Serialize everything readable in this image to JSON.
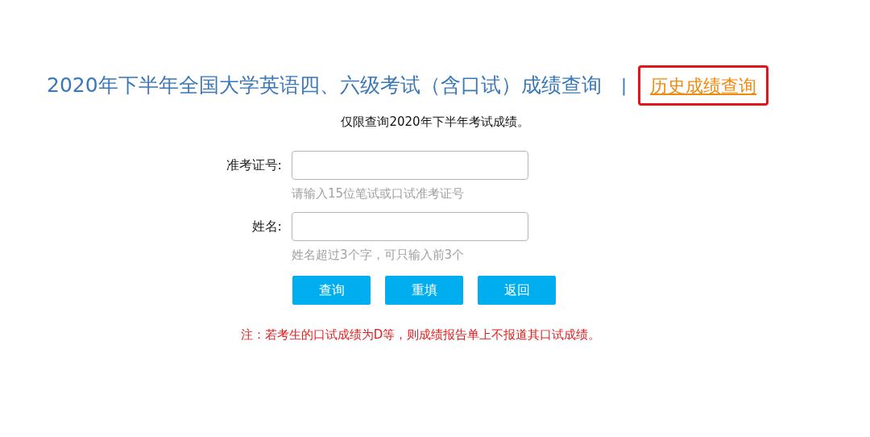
{
  "header": {
    "title": "2020年下半年全国大学英语四、六级考试（含口试）成绩查询",
    "separator": "|",
    "history_link": {
      "label": "历史成绩查询",
      "highlighted": true
    }
  },
  "subtitle": "仅限查询2020年下半年考试成绩。",
  "fields": [
    {
      "label": "准考证号:",
      "hint": "请输入15位笔试或口试准考证号"
    },
    {
      "label": "姓名:",
      "hint": "姓名超过3个字，可只输入前3个"
    }
  ],
  "buttons": [
    "查询",
    "重填",
    "返回"
  ],
  "note": "注：若考生的口试成绩为D等，则成绩报告单上不报道其口试成绩。"
}
